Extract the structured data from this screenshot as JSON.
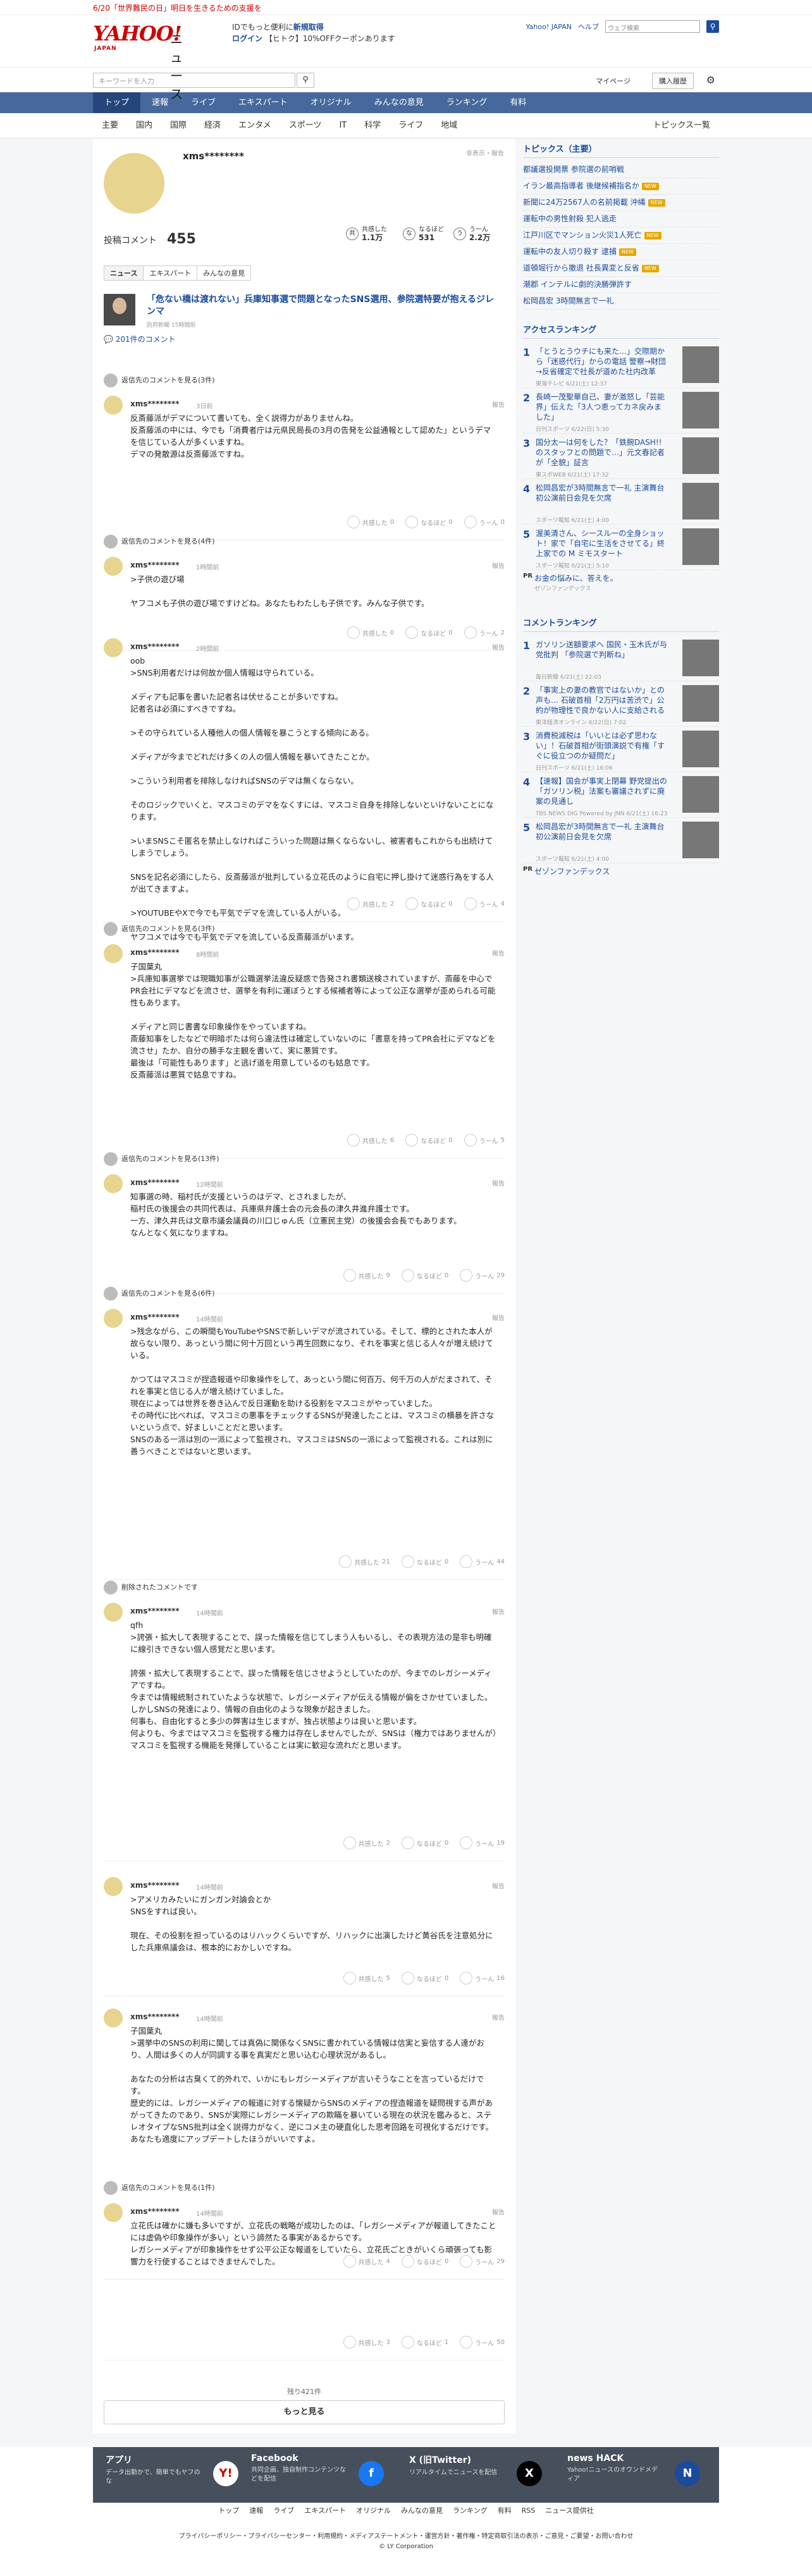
{
  "announce": "6/20「世界難民の日」明日を生きるための支援を",
  "header": {
    "logo": "YAHOO!",
    "logo_sub": "JAPAN",
    "site": "ニュース",
    "promo1": "IDでもっと便利に",
    "promo1b": "新規取得",
    "promo2": "ログイン",
    "promo3": "【ヒトク】10%OFFクーポンあります",
    "links": [
      "Yahoo! JAPAN",
      "ヘルプ"
    ],
    "search_placeholder": "ウェブ検索",
    "search_btn": "三 他探索",
    "search2_placeholder": "キーワードを入力",
    "mypage": "マイページ",
    "purchase": "購入履歴"
  },
  "gnav": [
    "トップ",
    "速報",
    "ライブ",
    "エキスパート",
    "オリジナル",
    "みんなの意見",
    "ランキング",
    "有料"
  ],
  "subnav": [
    "主要",
    "国内",
    "国際",
    "経済",
    "エンタメ",
    "スポーツ",
    "IT",
    "科学",
    "ライフ",
    "地域"
  ],
  "subnav_right": "トピックス一覧",
  "profile": {
    "name": "xms********",
    "hidden": "非表示・報告",
    "count_label": "投稿コメント",
    "count": "455",
    "stats": [
      {
        "icon": "共",
        "label": "共感した",
        "value": "1.1万"
      },
      {
        "icon": "な",
        "label": "なるほど",
        "value": "531"
      },
      {
        "icon": "う",
        "label": "うーん",
        "value": "2.2万"
      }
    ],
    "tabs": [
      "ニュース",
      "エキスパート",
      "みんなの意見"
    ]
  },
  "article": {
    "title": "「危ない橋は渡れない」兵庫知事選で問題となったSNS選用、参院選特要が抱えるジレンマ",
    "source": "防府新聞 15時間前",
    "comments_link": "201件のコメント"
  },
  "comments": [
    {
      "rep": "返信先のコメントを見る(3件)",
      "name": "xms********",
      "time": "3日前",
      "body": "反斎藤派がデマについて書いても、全く説得力がありませんね。\n反斎藤派の中には、今でも「消費者庁は元県民局長の3月の告発を公益通報として認めた」というデマを信じている人が多くいますね。\nデマの発散源は反斎藤派ですね。",
      "r": [
        "0",
        "0",
        "0"
      ]
    },
    {
      "rep": "返信先のコメントを見る(4件)",
      "name": "xms********",
      "time": "1時間前",
      "body": ">子供の遊び場\n\nヤフコメも子供の遊び場ですけどね。あなたもわたしも子供です。みんな子供です。",
      "r": [
        "0",
        "0",
        "2"
      ]
    },
    {
      "rep": "",
      "name": "xms********",
      "time": "2時間前",
      "body": "oob\n>SNS利用者だけは何故か個人情報は守られている。\n\nメディアも記事を書いた記者名は伏せることが多いですね。\n記者名は必須にすべきですね。\n\n>その守られている人種他人の個人情報を暴こうとする傾向にある。\n\nメディアが今までどれだけ多くの人の個人情報を暴いてきたことか。\n\n>こういう利用者を排除しなければSNSのデマは無くならない。\n\nそのロジックでいくと、マスコミのデマをなくすには、マスコミ自身を排除しないといけないことになります。\n\n>いまSNSこそ匿名を禁止しなければこういった問題は無くならないし、被害者もこれからも出続けてしまうでしょう。\n\nSNSを記名必須にしたら、反斎藤派が批判している立花氏のように自宅に押し掛けて迷惑行為をする人が出てきますよ。\n\n>YOUTUBEやXで今でも平気でデマを流している人がいる。\n\nヤフコメでは今でも平気でデマを流している反斎藤派がいます。",
      "r": [
        "2",
        "0",
        "4"
      ]
    },
    {
      "rep": "返信先のコメントを見る(3件)",
      "name": "xms********",
      "time": "8時間前",
      "body": "子国葉丸\n>兵庫知事選挙では現職知事が公職選挙法違反疑惑で告発され書類送検されていますが、斎藤を中心でPR会社にデマなどを流させ、選挙を有利に運ぼうとする候補者等によって公正な選挙が歪められる可能性もあります。\n\nメディアと同じ書書な印象操作をやっていますね。\n斎藤知事をしたなどで明暗ボたは何ら違法性は確定していないのに「書意を持ってPR会社にデマなどを流させ」たか、自分の勝手な主観を書いて、実に悪質です。\n最後は「可能性もあります」と逃げ道を用意しているのも姑息です。\n反斎藤派は悪質で姑息ですね。",
      "r": [
        "6",
        "0",
        "5"
      ]
    },
    {
      "rep": "返信先のコメントを見る(13件)",
      "name": "xms********",
      "time": "12時間前",
      "body": "知事選の時、稲村氏が支援というのはデマ、とされましたが、\n稲村氏の後援会の共同代表は、兵庫県弁護士会の元会長の津久井進弁護士です。\n一方、津久井氏は文章市議会議員の川口じゅん氏（立憲民主党）の後援会会長でもあります。\nなんとなく気になりますね。",
      "r": [
        "9",
        "0",
        "29"
      ]
    },
    {
      "rep": "返信先のコメントを見る(6件)",
      "name": "xms********",
      "time": "14時間前",
      "body": ">残念ながら、この瞬間もYouTubeやSNSで新しいデマが流されている。そして、標的とされた本人が故らない限り、あっという間に何十万回という再生回数になり、それを事実と信じる人々が増え続けている。\n\nかつてはマスコミが捏造報道や印象操作をして、あっという間に何百万、何千万の人がだまされて、それを事実と信じる人が増え続けていました。\n現在によっては世界を巻き込んで反日運動を助ける役割をマスコミがやっていました。\nその時代に比べれば、マスコミの悪事をチェックするSNSが発達したことは、マスコミの横暴を許さないという点で、好ましいことだと思います。\nSNSのある一派は別の一派によって監視され、マスコミはSNSの一派によって監視される。これは別に善うべきことではないと思います。",
      "r": [
        "21",
        "0",
        "44"
      ]
    },
    {
      "rep": "削除されたコメントです",
      "name": "xms********",
      "time": "14時間前",
      "body": "qfh\n>誇張・拡大して表現することで、誤った情報を信じてしまう人もいるし、その表現方法の是非も明確に線引きできない個人感覚だと思います。\n\n誇張・拡大して表現することで、誤った情報を信じさせようとしていたのが、今までのレガシーメディアですね。\n今までは情報統制されていたような状態で、レガシーメディアが伝える情報が偏をさかせていました。\nしかしSNSの発達により、情報の自由化のような現象が起きました。\n何事も、自由化すると多少の弊害は生じますが、独占状態よりは良いと思います。\n何よりも、今まではマスコミを監視する権力は存在しませんでしたが、SNSは（権力ではありませんが）マスコミを監視する機能を発揮していることは実に歓迎な流れだと思います。",
      "r": [
        "2",
        "0",
        "19"
      ]
    },
    {
      "rep": "",
      "name": "xms********",
      "time": "14時間前",
      "body": ">アメリカみたいにガンガン対論会とか\nSNSをすれば良い。\n\n現在、その役割を担っているのはリハックくらいですが、リハックに出演したけど黄谷氏を注意処分にした兵庫県議会は、根本的におかしいですね。",
      "r": [
        "5",
        "0",
        "16"
      ]
    },
    {
      "rep": "",
      "name": "xms********",
      "time": "14時間前",
      "body": "子国葉丸\n>選挙中のSNSの利用に関しては真偽に関係なくSNSに書かれている情報は信実と妄信する人達がおり、人間は多くの人が同調する事を真実だと思い込む心理状況があるし。\n\nあなたの分析は古臭くて的外れで、いかにもレガシーメディアが言いそうなことを言っているだけです。\n歴史的には、レガシーメディアの報道に対する懐疑からSNSのメディアの捏造報道を疑問視する声があがってきたのであり、SNSが実際にレガシーメディアの欺瞞を暴いている現在の状況を鑑みると、ステレオタイプなSNS批判は全く説得力がなく、逆にコメ主の硬直化した思考回路を可視化するだけです。\nあなたも適度にアップデートしたほうがいいですよ。",
      "r": [
        "4",
        "0",
        "29"
      ]
    },
    {
      "rep": "返信先のコメントを見る(1件)",
      "name": "xms********",
      "time": "14時間前",
      "body": "立花氏は確かに嫌も多いですが、立花氏の戦略が成功したのは、「レガシーメディアが報道してきたことには虚偽や印象操作が多い」という諦然たる事実があるからです。\nレガシーメディアが印象操作をせず公平公正な報道をしていたら、立花氏ごときがいくら頑張っても影響力を行使することはできませんでした。",
      "r": [
        "3",
        "1",
        "50"
      ]
    }
  ],
  "more": {
    "remaining": "残り421件",
    "button": "もっと見る"
  },
  "sidebar": {
    "topics_title": "トピックス（主要）",
    "topics": [
      {
        "text": "都議選投開票 参院選の前哨戦",
        "tag": ""
      },
      {
        "text": "イラン最高指導者 後継候補指名か",
        "tag": "NEW"
      },
      {
        "text": "新聞に24万2567人の名前掲載 沖縄",
        "tag": "NEW"
      },
      {
        "text": "運転中の男性射殺 犯人逃走",
        "tag": ""
      },
      {
        "text": "江戸川区でマンション火災1人死亡",
        "tag": "NEW"
      },
      {
        "text": "運転中の友人切り殺す 逮捕",
        "tag": "NEW"
      },
      {
        "text": "道頓堀行から撤退 社長異変と反省",
        "tag": "NEW"
      },
      {
        "text": "潮郡 インテルに劇的決勝弾許す",
        "tag": ""
      },
      {
        "text": "松岡昌宏 3時間無言で一礼",
        "tag": ""
      }
    ],
    "access_title": "アクセスランキング",
    "access": [
      {
        "n": "1",
        "t": "「とうとうウチにも来た…」交際期から「迷惑代行」からの電話 警察→財団→反省確定で社長が道めた社内改革",
        "s": "東海テレビ 6/21(土) 12:37"
      },
      {
        "n": "2",
        "t": "長崎一茂聖華自己、妻が激怒し「芸能界」伝えた「3人つ恵ってカネ戻みました」",
        "s": "日刊スポーツ 6/22(日) 5:30"
      },
      {
        "n": "3",
        "t": "国分太一は何をした？「鉄腕DASH!!のスタッフとの問題で…」元文春記者が「全貌」証言",
        "s": "東スポWEB 6/21(土) 17:32"
      },
      {
        "n": "4",
        "t": "松岡昌宏が3時間無言で一礼 主演舞台初公演前日会見を欠席",
        "s": "スポーツ報知 6/21(土) 4:00"
      },
      {
        "n": "5",
        "t": "渥美清さん、シースル一の全身ショット！家で「自宅に生活をさせてる」終上家での M ミモスタート",
        "s": "スポーツ報知 6/21(土) 5:10"
      }
    ],
    "pr1": {
      "badge": "PR",
      "t": "お金の悩みに、答えを。",
      "s": "ゼゾンファンデックス"
    },
    "comment_title": "コメントランキング",
    "comment_rank": [
      {
        "n": "1",
        "t": "ガソリン送額要求へ 国民・玉木氏が与党批判 「参院選で判断ね」",
        "s": "毎日新聞 6/21(土) 22:03"
      },
      {
        "n": "2",
        "t": "「事実上の妻の教官ではないか」との声も… 石破首相「2万円は苦渋で」公約が物理性で良かない人に支給される",
        "s": "東洋経済オンライン 6/22(日) 7:02"
      },
      {
        "n": "3",
        "t": "消費税減税は「いいとは必ず思わない」！石破首相が街頭演説で有権「すぐに役立つのか疑問だ」",
        "s": "日刊スポーツ 6/21(土) 16:06"
      },
      {
        "n": "4",
        "t": "【速報】国会が事実上閉幕 野党提出の「ガソリン税」法案も審議されずに廃案の見通し",
        "s": "TBS NEWS DIG Powered by JNN 6/21(土) 16:23"
      },
      {
        "n": "5",
        "t": "松岡昌宏が3時間無言で一礼 主演舞台初公演前日会見を欠席",
        "s": "スポーツ報知 6/21(土) 4:00"
      }
    ],
    "pr2": {
      "badge": "PR",
      "t": "ゼゾンファンデックス",
      "s": ""
    }
  },
  "footer": {
    "cols": [
      {
        "h": "アプリ",
        "d": "データ出勤かで、簡単でもヤフのな",
        "logo": "Y!"
      },
      {
        "h": "Facebook",
        "d": "共同企画、独自制作コンテンツなどを配信",
        "logo": "f"
      },
      {
        "h": "X (旧Twitter)",
        "d": "リアルタイムでニュースを配信",
        "logo": "X"
      },
      {
        "h": "news HACK",
        "d": "Yahoo!ニュースのオウンドメディア",
        "logo": "N"
      }
    ],
    "nav": [
      "トップ",
      "速報",
      "ライブ",
      "エキスパート",
      "オリジナル",
      "みんなの意見",
      "ランキング",
      "有料",
      "RSS",
      "ニュース提供社"
    ],
    "links": "プライバシーポリシー・プライバシーセンター・利用規約・メディアステートメント・運営方針・著作権・特定商取引法の表示・ご意見・ご要望・お問い合わせ",
    "copy": "© LY Corporation"
  }
}
